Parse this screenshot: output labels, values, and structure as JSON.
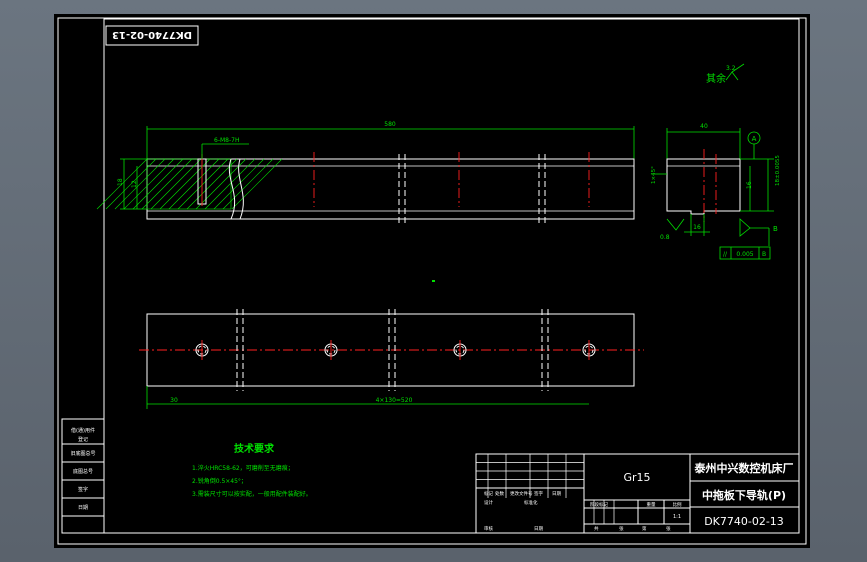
{
  "drawing_number": "DK7740-02-13",
  "roughness_note": "其余",
  "roughness_value": "3.2",
  "front_view": {
    "overall_length": "580",
    "thread_callout": "6-M8-7H",
    "dim_height_left": "18",
    "dim_height_inner": "12",
    "break_count": 3
  },
  "section_view": {
    "dim_width_top": "40",
    "datum_top": "A",
    "datum_bottom": "B",
    "dim_right": "18±0.0055",
    "dim_right_inner": "16",
    "dim_left": "1×45°",
    "dim_bottom_left": "0.8",
    "dim_bottom_mid": "16",
    "tolerance_symbol": "//",
    "tolerance_value": "0.005",
    "tolerance_datum": "B"
  },
  "plan_view": {
    "dim_start": "30",
    "dim_spacing": "4×130=520",
    "holes": 4
  },
  "technical_requirements": {
    "title": "技术要求",
    "items": [
      "1.淬火HRC58-62，可磨削至无磨痕；",
      "2.锐角倒0.5×45°；",
      "3.需装尺寸可以按实配，一般用配件装配好。"
    ]
  },
  "title_block": {
    "material": "Gr15",
    "company": "泰州中兴数控机床厂",
    "part_name": "中拖板下导轨(P)",
    "drawing_code": "DK7740-02-13",
    "scale": "1:1",
    "row_labels": [
      "标记",
      "处数",
      "更改文件号",
      "签字",
      "日期"
    ],
    "bottom_labels": [
      "设计",
      "标准化",
      "审核",
      "工艺",
      "批准",
      "日期"
    ],
    "sub_labels": [
      "共",
      "张",
      "第",
      "张"
    ],
    "stage_labels": [
      "阶段标记",
      "重量",
      "比例"
    ]
  },
  "left_sidebar": {
    "items": [
      "借(通)用件",
      "登记",
      "旧底图总号",
      "底图总号",
      "签字",
      "日期"
    ]
  }
}
